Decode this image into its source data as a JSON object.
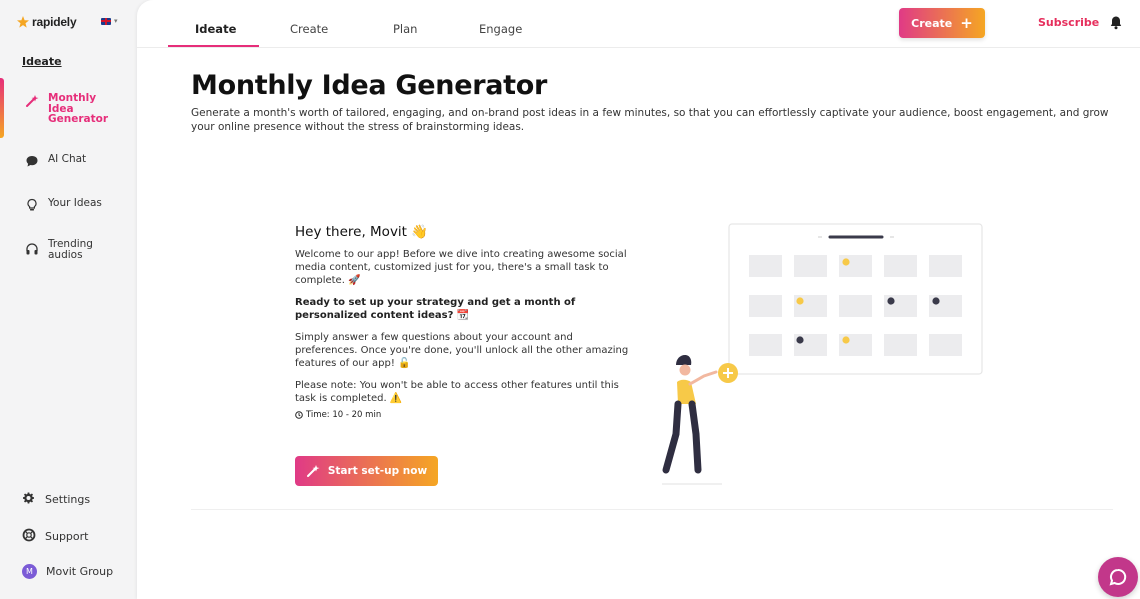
{
  "app": {
    "logo_text": "rapidely",
    "language_flag": "uk-flag-icon"
  },
  "sidebar": {
    "section_title": "Ideate",
    "items": [
      {
        "label": "Monthly Idea Generator",
        "icon": "magic-wand-icon",
        "active": true
      },
      {
        "label": "AI Chat",
        "icon": "chat-bubble-icon",
        "active": false
      },
      {
        "label": "Your Ideas",
        "icon": "lightbulb-icon",
        "active": false
      },
      {
        "label": "Trending audios",
        "icon": "headphones-icon",
        "active": false
      }
    ],
    "bottom": [
      {
        "label": "Settings",
        "icon": "gear-icon"
      },
      {
        "label": "Support",
        "icon": "lifebuoy-icon"
      },
      {
        "label": "Movit Group",
        "icon": "avatar",
        "avatar_letter": "M"
      }
    ]
  },
  "header": {
    "tabs": [
      "Ideate",
      "Create",
      "Plan",
      "Engage"
    ],
    "active_tab": "Ideate",
    "create_label": "Create",
    "subscribe_label": "Subscribe"
  },
  "main": {
    "title": "Monthly Idea Generator",
    "description": "Generate a month's worth of tailored, engaging, and on-brand post ideas in a few minutes, so that you can effortlessly captivate your audience, boost engagement, and grow your online presence without the stress of brainstorming ideas.",
    "greeting": "Hey there, Movit 👋",
    "welcome_text": "Welcome to our app! Before we dive into creating awesome social media content, customized just for you, there's a small task to complete. 🚀",
    "ready_text": "Ready to set up your strategy and get a month of personalized content ideas? 📆",
    "answer_text": "Simply answer a few questions about your account and preferences. Once you're done, you'll unlock all the other amazing features of our app! 🔓",
    "note_text": "Please note: You won't be able to access other features until this task is completed. ⚠️",
    "time_text": "Time: 10 - 20 min",
    "start_button": "Start set-up now"
  },
  "colors": {
    "accent_pink": "#e62e7a",
    "accent_orange": "#f5a623",
    "chat_fab": "#c2378a"
  }
}
